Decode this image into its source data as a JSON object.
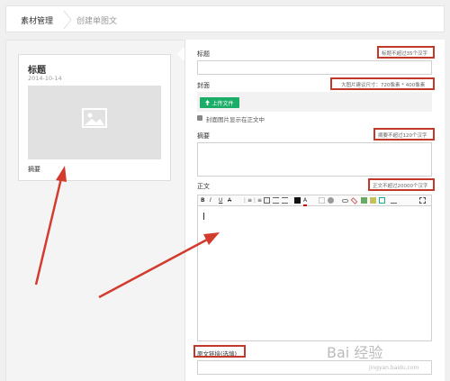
{
  "breadcrumb": {
    "root": "素材管理",
    "current": "创建单图文"
  },
  "preview": {
    "title": "标题",
    "date": "2014-10-14",
    "summary": "摘要"
  },
  "form": {
    "title_label": "标题",
    "title_hint": "标题不超过35个汉字",
    "cover_label": "封面",
    "cover_hint": "大图片建议尺寸：720像素 * 400像素",
    "upload_label": "上传文件",
    "show_cover_label": "封面图片显示在正文中",
    "summary_label": "摘要",
    "summary_hint": "摘要不超过120个汉字",
    "body_label": "正文",
    "body_hint": "正文不超过20000个汉字",
    "source_link_label": "原文链接(选填)"
  },
  "toolbar": {
    "bold": "B",
    "italic": "I",
    "underline": "U",
    "strike": "A",
    "ordered_list": "⋮≡",
    "bullet_list": "⋮≡",
    "font_color": "A",
    "icons": [
      "bold-icon",
      "italic-icon",
      "underline-icon",
      "strikethrough-icon",
      "ordered-list-icon",
      "unordered-list-icon",
      "align-left-icon",
      "align-center-icon",
      "align-right-icon",
      "color-block-icon",
      "font-color-icon",
      "background-color-icon",
      "highlight-icon",
      "link-icon",
      "unlink-icon",
      "image-icon",
      "video-icon",
      "table-icon",
      "emoji-icon",
      "fullscreen-icon"
    ]
  },
  "watermark": {
    "text": "Bai 经验",
    "sub": "jingyan.baidu.com"
  },
  "colors": {
    "accent_green": "#1aad68",
    "annotation_red": "#c0392b"
  }
}
